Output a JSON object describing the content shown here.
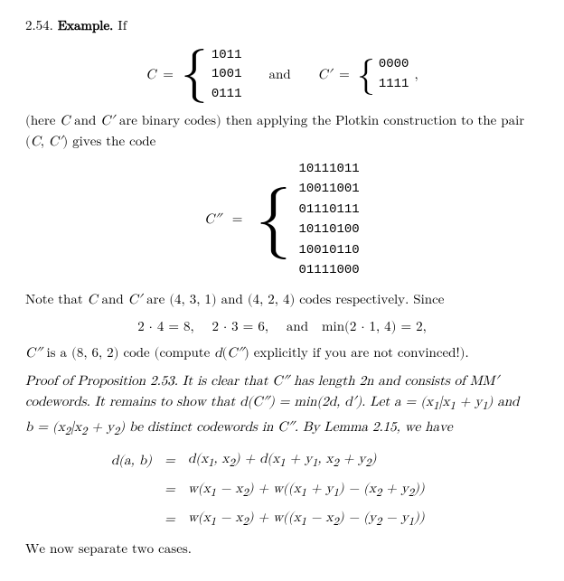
{
  "section": "2.54.",
  "example_label": "Example.",
  "intro_text": "If",
  "C_label": "C",
  "C_prime_label": "C′",
  "and_1": "and",
  "comma": ",",
  "C_matrix": [
    "1011",
    "1001",
    "0111"
  ],
  "C_prime_matrix": [
    "0000",
    "1111"
  ],
  "parenthetical": "(here C and C′ are binary codes) then applying the Plotkin construction to the pair (C, C′) gives the code",
  "C_double_prime_label": "C″",
  "C_double_prime_matrix": [
    "10111011",
    "10011001",
    "01110111",
    "10110100",
    "10010110",
    "01111000"
  ],
  "note_text": "Note that C and C′ are (4, 3, 1) and (4, 2, 4) codes respectively. Since",
  "calc_line": "2 · 4 = 8,   2 · 3 = 6,   and   min(2 · 1, 4) = 2,",
  "c_double_code_desc": "C″ is a (8, 6, 2) code (compute d(C″) explicitly if you are not convinced!).",
  "proof_title": "Proof of Proposition 2.53.",
  "proof_text1": "It is clear that C″ has length 2n and consists of MM′",
  "proof_text2": "codewords. It remains to show that d(C″) = min(2d, d′). Let a = (x₁|x₁ + y₁) and",
  "proof_text3": "b = (x₂|x₂ + y₂) be distinct codewords in C″. By Lemma 2.15, we have",
  "da_b": "d(a, b)",
  "eq": "=",
  "rhs1": "d(x₁, x₂) + d(x₁ + y₁, x₂ + y₂)",
  "rhs2": "w(x₁ − x₂) + w((x₁ + y₁) − (x₂ + y₂))",
  "rhs3": "w(x₁ − x₂) + w((x₁ − x₂) − (y₂ − y₁))",
  "conclusion": "We now separate two cases."
}
